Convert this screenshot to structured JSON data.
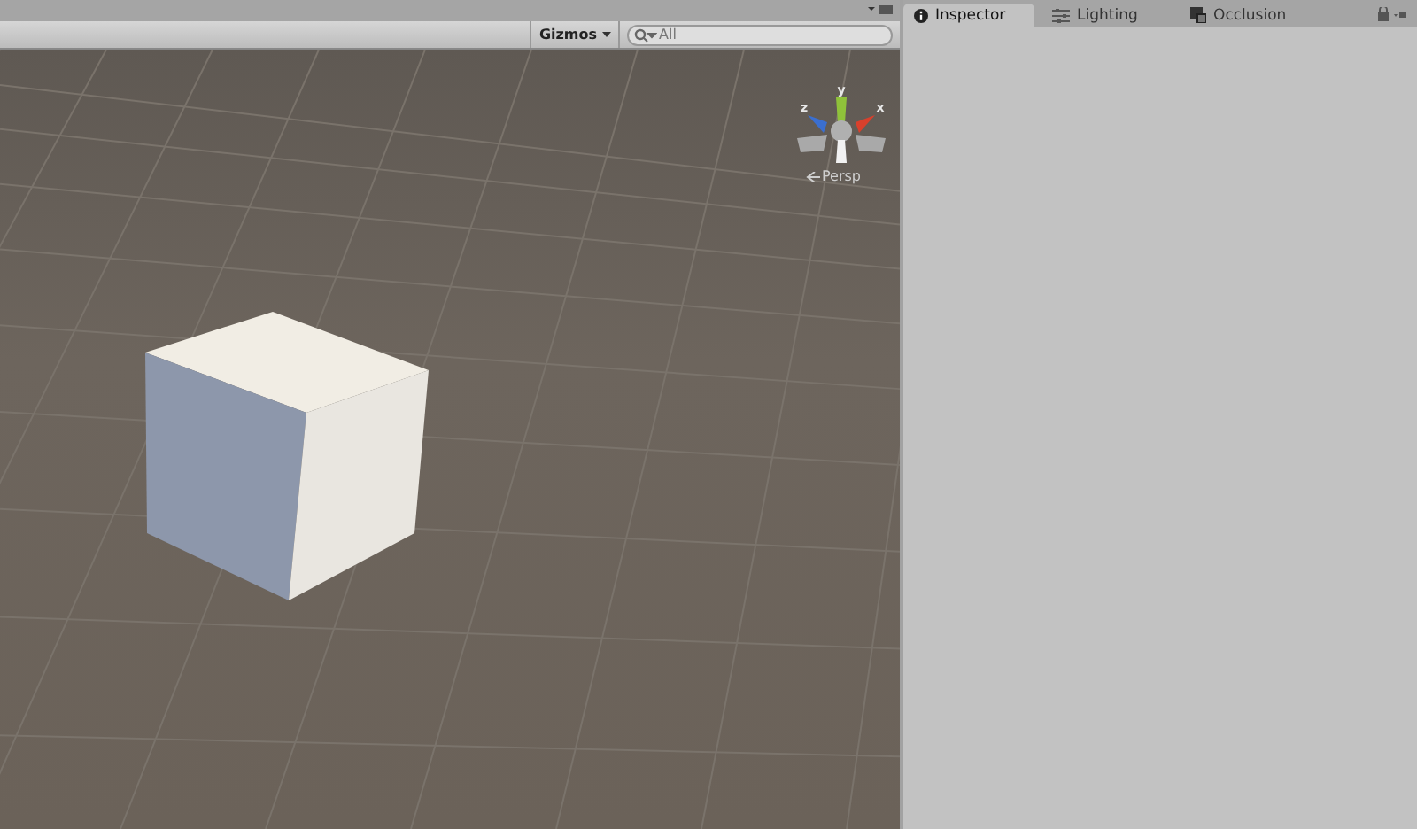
{
  "scene_toolbar": {
    "gizmos_button": "Gizmos",
    "search": {
      "placeholder": "All"
    }
  },
  "scene_view": {
    "projection_label": "Persp",
    "axis_labels": [
      "y",
      "z",
      "x"
    ]
  },
  "tabs": [
    {
      "label": "Inspector",
      "kind": "info",
      "selected": true
    },
    {
      "label": "Lighting",
      "kind": "sliders",
      "selected": false
    },
    {
      "label": "Occlusion",
      "kind": "occlusion",
      "selected": false
    }
  ]
}
